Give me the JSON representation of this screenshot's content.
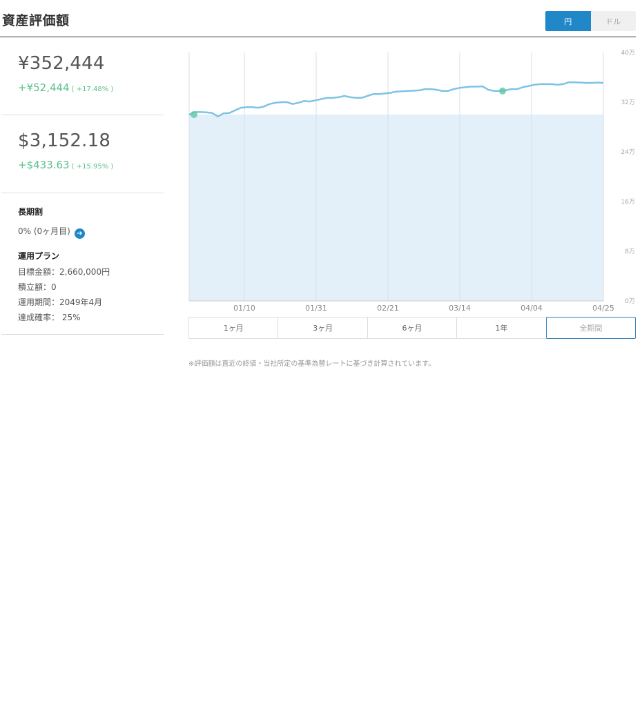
{
  "header": {
    "title": "資産評価額",
    "currency_options": [
      "円",
      "ドル"
    ],
    "currency_selected": "円"
  },
  "summary": {
    "yen": {
      "value": "¥352,444",
      "gain": "+¥52,444",
      "gain_pct": "( +17.48% )"
    },
    "usd": {
      "value": "$3,152.18",
      "gain": "+$433.63",
      "gain_pct": "( +15.95% )"
    }
  },
  "plan": {
    "long_term_label": "長期割",
    "long_term_value": "0% (0ヶ月目)",
    "plan_label": "運用プラン",
    "target_amount": "目標金額：2,660,000円",
    "monthly_amount": "積立額：0",
    "period": "運用期間：2049年4月",
    "probability": "達成確率： 25%"
  },
  "period_tabs": [
    "1ヶ月",
    "3ヶ月",
    "6ヶ月",
    "1年",
    "全期間"
  ],
  "period_selected": "全期間",
  "footnote": "※評価額は直近の終値・当社所定の基準為替レートに基づき計算されています。",
  "colors": {
    "accent": "#2087c8",
    "gain": "#5abf8c",
    "line": "#7ec3e3",
    "area": "#e3f0f9"
  },
  "chart_data": {
    "type": "line",
    "x_tick_labels": [
      "01/10",
      "01/31",
      "02/21",
      "03/14",
      "04/04",
      "04/25"
    ],
    "y_tick_labels": [
      "0万",
      "8万",
      "16万",
      "24万",
      "32万",
      "40万"
    ],
    "ylim": [
      0,
      400000
    ],
    "grid": true,
    "series": [
      {
        "values": [
          300000,
          304000,
          304000,
          303500,
          302500,
          297000,
          302000,
          302500,
          307000,
          311000,
          312000,
          312000,
          311000,
          313000,
          317000,
          319000,
          320000,
          320000,
          317000,
          319000,
          322000,
          321000,
          323000,
          325000,
          327000,
          327000,
          328000,
          330000,
          328000,
          327000,
          327000,
          330000,
          333000,
          333000,
          334000,
          335000,
          337000,
          337500,
          338000,
          338500,
          339000,
          341000,
          341000,
          340000,
          338000,
          338000,
          341000,
          343000,
          344000,
          345000,
          345000,
          345500,
          340000,
          338000,
          338000,
          339000,
          341000,
          341000,
          344000,
          346000,
          348000,
          349000,
          349000,
          349000,
          348000,
          349000,
          352000,
          352000,
          351500,
          351000,
          351000,
          351500,
          351000
        ]
      }
    ],
    "area_level": 300000,
    "markers": [
      300000,
      338000
    ]
  }
}
